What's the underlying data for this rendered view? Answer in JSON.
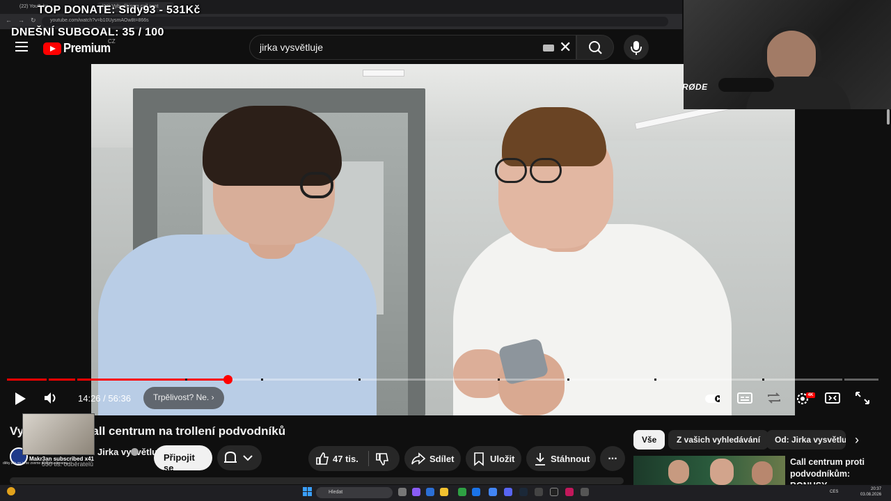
{
  "browser": {
    "tab1": "(22) YouTube",
    "tab2": "(22) Vybudil jsem call cent",
    "url": "youtube.com/watch?v=b10UysmAOw8t=866s"
  },
  "overlay": {
    "donate": "TOP DONATE: Sidy93 - 531Kč",
    "subgoal": "DNEŠNÍ SUBGOAL:  35 / 100",
    "mic_brand": "RØDE",
    "alert_user": "Makr3an",
    "alert_text": "subscribed",
    "alert_count": "x41",
    "alert_fine": "děky kilo se jsme zveme podporu streamu..."
  },
  "header": {
    "logo_text": "Premium",
    "country": "CZ",
    "search_value": "jirka vysvětluje"
  },
  "player": {
    "current_time": "14:26",
    "separator": "/",
    "duration": "56:36",
    "chapter": "Trpělivost? Ne.",
    "progress": 0.253,
    "hd_badge": "4K"
  },
  "video": {
    "title": "Vybudil jsem call centrum na trollení podvodníků",
    "channel": "Jirka vysvětluje věci",
    "subscribers": "550 tis. odběratelů",
    "join_label": "Připojit se",
    "likes": "47 tis.",
    "share": "Sdílet",
    "save": "Uložit",
    "download": "Stáhnout",
    "more": "..."
  },
  "sidebar": {
    "chips": [
      "Vše",
      "Z vašich vyhledávání",
      "Od: Jirka vysvětlu"
    ],
    "rec_title": "Call centrum proti podvodníkům: BONUSY"
  },
  "taskbar": {
    "search": "Hledat",
    "lang": "CES",
    "time": "20:37",
    "date": "03.08.2026"
  },
  "colors": {
    "accent": "#ff0000",
    "bg": "#0f0f0f",
    "button": "#272727"
  }
}
